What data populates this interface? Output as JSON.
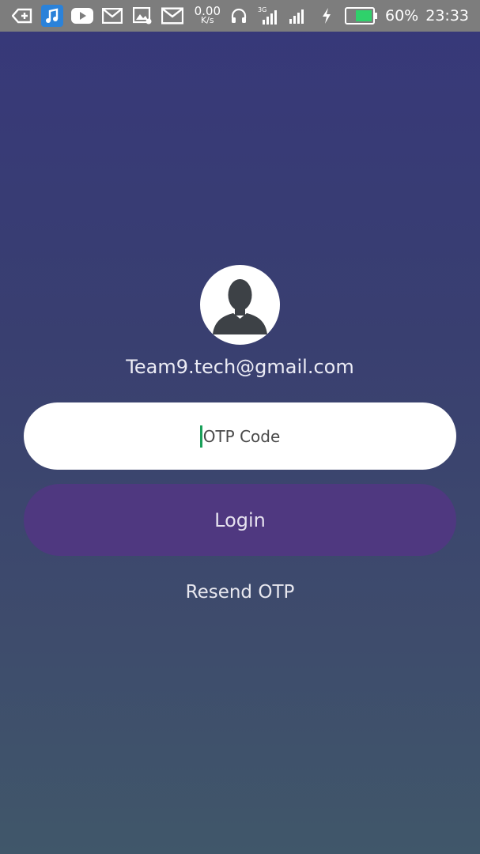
{
  "status_bar": {
    "net_speed_value": "0.00",
    "net_speed_unit": "K/s",
    "network_type": "3G",
    "battery_percent": "60%",
    "time": "23:33",
    "left_icons": [
      "back-add-icon",
      "music-app-icon",
      "youtube-icon",
      "gmail-icon",
      "gallery-icon",
      "gmail-icon"
    ],
    "right_icons": [
      "headphones-icon",
      "signal-3g-icon",
      "signal-icon",
      "charging-icon",
      "battery-icon"
    ],
    "colors": {
      "bar": "#7d7d7d",
      "battery_fill": "#2fd16b"
    }
  },
  "profile": {
    "avatar_icon": "user-silhouette-icon",
    "email": "Team9.tech@gmail.com"
  },
  "form": {
    "otp_placeholder": "OTP Code",
    "otp_value": "",
    "login_label": "Login",
    "resend_label": "Resend OTP"
  },
  "colors": {
    "background_top": "#37387a",
    "background_bottom": "#40576a",
    "login_button": "#4f3880",
    "caret": "#1aa05a"
  }
}
